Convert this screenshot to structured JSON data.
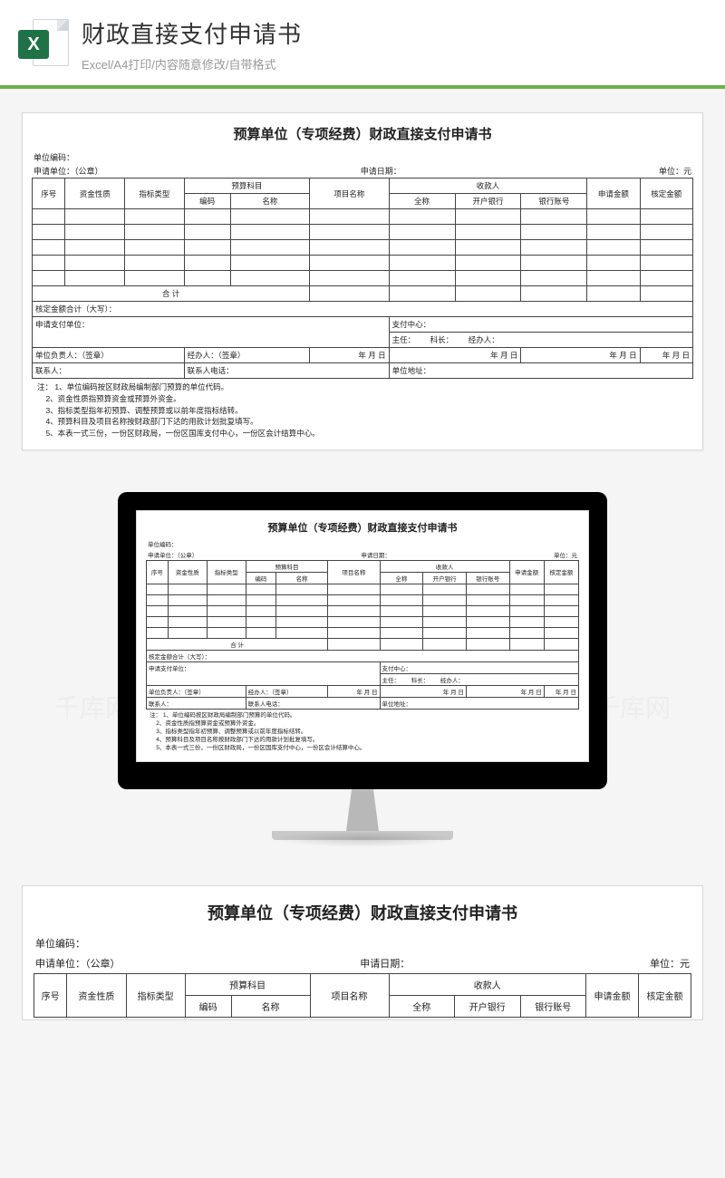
{
  "header": {
    "title": "财政直接支付申请书",
    "subtitle": "Excel/A4打印/内容随意修改/自带格式",
    "icon_letter": "X"
  },
  "watermark": "千库网",
  "doc": {
    "title": "预算单位（专项经费）财政直接支付申请书",
    "unit_code_label": "单位编码：",
    "apply_unit_label": "申请单位：（公章）",
    "apply_date_label": "申请日期：",
    "currency_label": "单位：元",
    "cols": {
      "seq": "序号",
      "fund_nature": "资金性质",
      "index_type": "指标类型",
      "budget_subject": "预算科目",
      "code": "编码",
      "name": "名称",
      "project_name": "项目名称",
      "payee": "收款人",
      "full_name": "全称",
      "bank": "开户银行",
      "account": "银行账号",
      "apply_amount": "申请金额",
      "approved_amount": "核定金额"
    },
    "total_label": "合        计",
    "approved_cn_label": "核定金额合计（大写）：",
    "apply_pay_unit_label": "申请支付单位：",
    "pay_center_label": "支付中心：",
    "director_label": "主任：",
    "section_chief_label": "科长：",
    "handler_center_label": "经办人：",
    "unit_leader_label": "单位负责人：（签章）",
    "handler_label": "经办人：（签章）",
    "date_ymd": "年    月    日",
    "date_ymd_short": "年  月  日",
    "contact_label": "联系人：",
    "contact_phone_label": "联系人电话：",
    "unit_addr_label": "单位地址：",
    "notes_title": "注：",
    "notes": [
      "1、单位编码按区财政局编制部门预算的单位代码。",
      "2、资金性质指预算资金或预算外资金。",
      "3、指标类型指年初预算、调整预算或以前年度指标结转。",
      "4、预算科目及项目名称按财政部门下达的用款计划批复填写。",
      "5、本表一式三份，一份区财政局，一份区国库支付中心，一份区会计结算中心。"
    ]
  }
}
